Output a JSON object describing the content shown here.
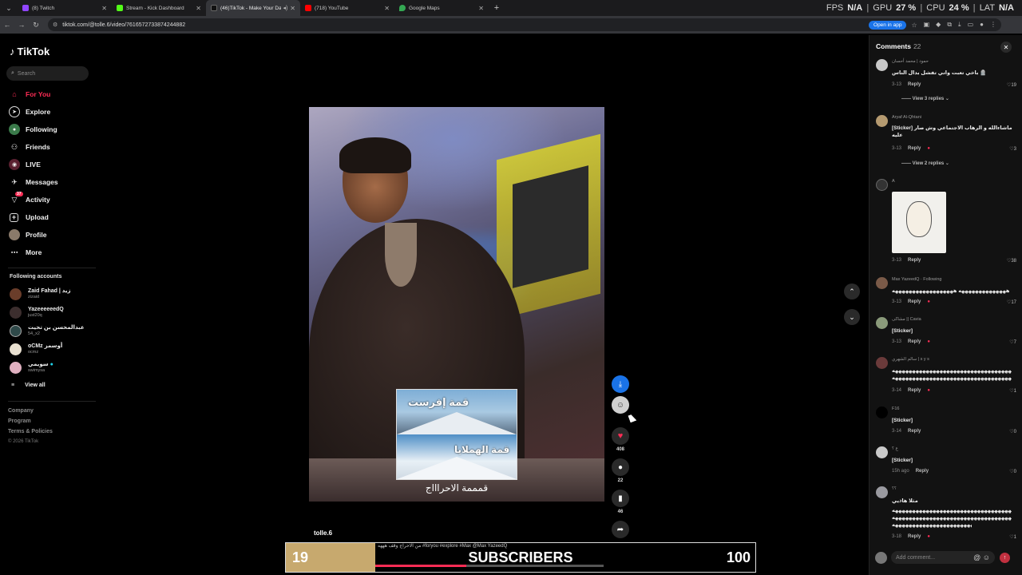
{
  "browser": {
    "tabs": [
      {
        "title": "(8) Twitch",
        "color": "#9146ff"
      },
      {
        "title": "Stream - Kick Dashboard",
        "color": "#53fc18"
      },
      {
        "title": "(46)TikTok - Make Your Day",
        "color": "#111111"
      },
      {
        "title": "(718) YouTube",
        "color": "#ff0000"
      },
      {
        "title": "Google Maps",
        "color": "#34a853"
      }
    ],
    "url": "tiktok.com/@tolle.6/video/7616572733874244882",
    "open_in_app": "Open in app",
    "perf": {
      "fps_label": "FPS",
      "fps_value": "N/A",
      "gpu_label": "GPU",
      "gpu_value": "27 %",
      "cpu_label": "CPU",
      "cpu_value": "24 %",
      "lat_label": "LAT",
      "lat_value": "N/A"
    }
  },
  "sidebar": {
    "logo": "TikTok",
    "search_placeholder": "Search",
    "nav": [
      {
        "label": "For You",
        "icon": "home-icon"
      },
      {
        "label": "Explore",
        "icon": "compass-icon"
      },
      {
        "label": "Following",
        "icon": "following-icon"
      },
      {
        "label": "Friends",
        "icon": "friends-icon"
      },
      {
        "label": "LIVE",
        "icon": "live-icon"
      },
      {
        "label": "Messages",
        "icon": "messages-icon"
      },
      {
        "label": "Activity",
        "icon": "activity-icon",
        "badge": "37"
      },
      {
        "label": "Upload",
        "icon": "upload-icon"
      },
      {
        "label": "Profile",
        "icon": "profile-icon"
      },
      {
        "label": "More",
        "icon": "more-icon"
      }
    ],
    "following_title": "Following accounts",
    "accounts": [
      {
        "name": "Zaid Fahad | زيد",
        "handle": "zizaid"
      },
      {
        "name": "YazeeeeeedQ",
        "handle": "just20q"
      },
      {
        "name": "عبدالمحسن بن تحيت",
        "handle": "54_x2"
      },
      {
        "name": "oCMz أوسمز",
        "handle": "ocmz"
      },
      {
        "name": "سويمي",
        "handle": "swimysa"
      }
    ],
    "view_all": "View all",
    "footer": [
      "Company",
      "Program",
      "Terms & Policies"
    ],
    "copyright": "© 2026 TikTok"
  },
  "video": {
    "card_top_text": "قمة إفرست",
    "card_bottom_text": "قمة الهملايا",
    "caption": "قمممة الاحراااج",
    "author": "tolle.6",
    "likes": "408",
    "comments": "22",
    "saves": "46"
  },
  "subscribers": {
    "current": "19",
    "goal": "100",
    "label": "SUBSCRIBERS",
    "progress": 0.19,
    "description": "من الاحراج وقف هههه #foryou #explore #Max @Max YazeedQ"
  },
  "comments": {
    "title": "Comments",
    "count": "22",
    "input_placeholder": "Add comment...",
    "items": [
      {
        "user": "حمود | محمد أحسان",
        "text": "باخي تعبت واني تفشل بدال الناس 🪦",
        "date": "3-13",
        "likes": "19",
        "more": "View 3 replies"
      },
      {
        "user": "Aryaf Al-Qhtani",
        "text": "[Sticker] ماشاءالله و الرهاب الاجتماعي وش صار عليه",
        "date": "3-13",
        "likes": "3",
        "more": "View 2 replies"
      },
      {
        "user": "A",
        "text": "",
        "date": "3-13",
        "likes": "38",
        "more": ""
      },
      {
        "user": "Max YazeedQ · Following",
        "text": "ههههههههههههههه ههههههههههههههههههه",
        "date": "3-13",
        "likes": "17",
        "more": ""
      },
      {
        "user": "مشاكى || Cavia",
        "text": "[Sticker]",
        "date": "3-13",
        "likes": "7",
        "more": ""
      },
      {
        "user": "سالم الشهري | s y s",
        "text": "هههههههههههههههههههههههههههههههههههههه",
        "date": "3-14",
        "likes": "1",
        "more": ""
      },
      {
        "user": "F16",
        "text": "[Sticker]",
        "date": "3-14",
        "likes": "0",
        "more": ""
      },
      {
        "user": "ع ؟",
        "text": "[Sticker]",
        "date": "15h ago",
        "likes": "0",
        "more": ""
      },
      {
        "user": "؟؟",
        "text": "مثلا هاذيي",
        "date": "3-18",
        "likes": "1",
        "more": ""
      }
    ],
    "reply_label": "Reply"
  }
}
